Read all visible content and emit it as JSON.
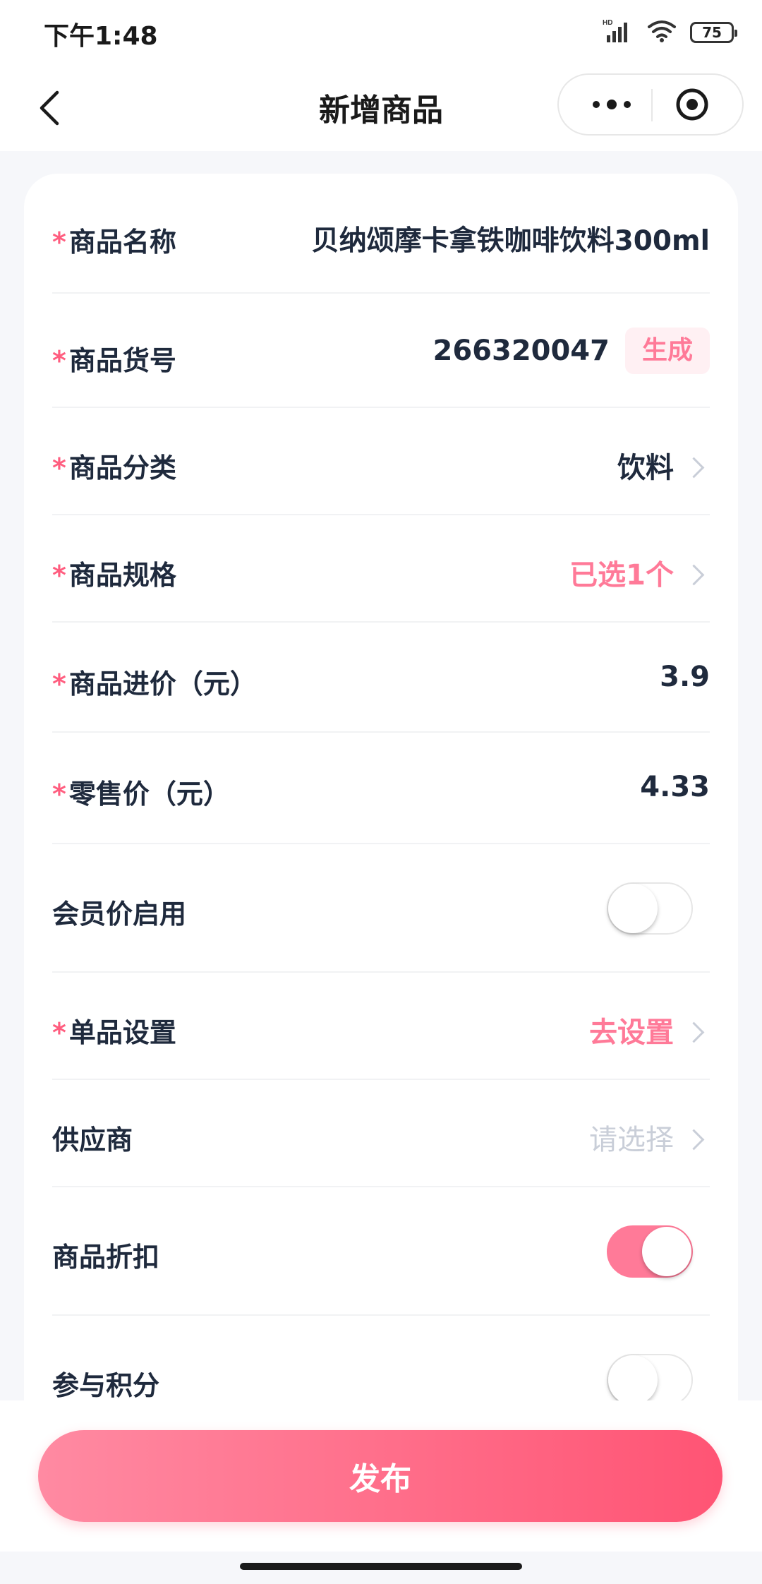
{
  "status_bar": {
    "time": "下午1:48",
    "network_badge": "HD",
    "battery": "75",
    "icons": [
      "signal-icon",
      "wifi-icon",
      "battery-icon"
    ]
  },
  "nav": {
    "title": "新增商品",
    "icons": [
      "back-arrow-icon",
      "more-dots-icon",
      "target-circle-icon"
    ]
  },
  "form": {
    "name": {
      "label": "商品名称",
      "required": "*",
      "value": "贝纳颂摩卡拿铁咖啡饮料300ml"
    },
    "code": {
      "label": "商品货号",
      "required": "*",
      "value": "266320047",
      "action": "生成"
    },
    "category": {
      "label": "商品分类",
      "required": "*",
      "value": "饮料"
    },
    "spec": {
      "label": "商品规格",
      "required": "*",
      "value": "已选1个"
    },
    "cost_price": {
      "label": "商品进价（元）",
      "required": "*",
      "value": "3.9"
    },
    "retail_price": {
      "label": "零售价（元）",
      "required": "*",
      "value": "4.33"
    },
    "member_price": {
      "label": "会员价启用",
      "enabled": false
    },
    "item_settings": {
      "label": "单品设置",
      "required": "*",
      "value": "去设置"
    },
    "supplier": {
      "label": "供应商",
      "placeholder": "请选择"
    },
    "discount": {
      "label": "商品折扣",
      "enabled": true
    },
    "points": {
      "label": "参与积分",
      "enabled": false
    }
  },
  "footer": {
    "publish_label": "发布"
  },
  "colors": {
    "accent": "#ff7a98",
    "accent_dark": "#ff5474",
    "text": "#1f2a3d",
    "placeholder": "#c9ced8"
  }
}
